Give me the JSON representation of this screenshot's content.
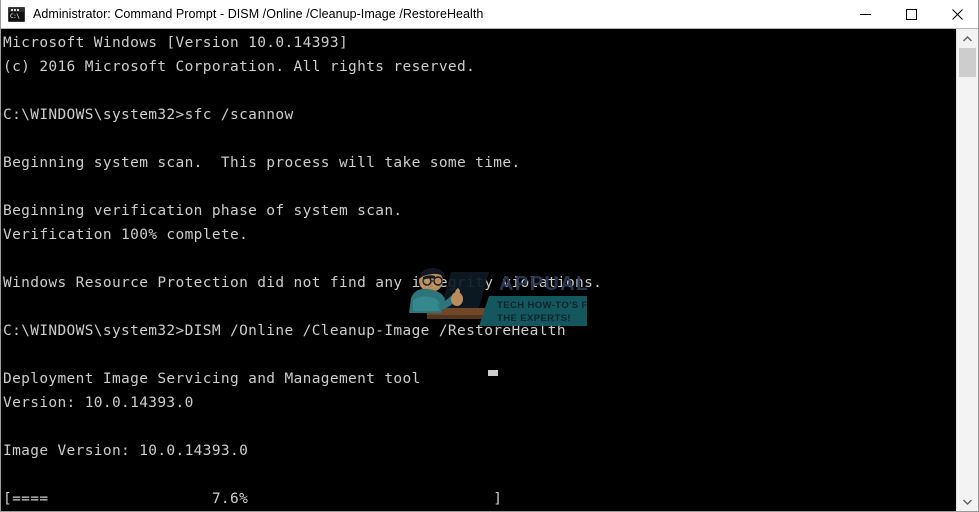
{
  "window": {
    "title": "Administrator: Command Prompt - DISM  /Online /Cleanup-Image /RestoreHealth",
    "icon_label": "C:\\",
    "icon_name": "command-prompt-icon",
    "background_color": "#000000",
    "titlebar_color": "#ffffff",
    "text_color": "#cccccc"
  },
  "controls": {
    "minimize_label": "Minimize",
    "maximize_label": "Maximize",
    "close_label": "Close"
  },
  "console": {
    "lines": [
      "Microsoft Windows [Version 10.0.14393]",
      "(c) 2016 Microsoft Corporation. All rights reserved.",
      "",
      "C:\\WINDOWS\\system32>sfc /scannow",
      "",
      "Beginning system scan.  This process will take some time.",
      "",
      "Beginning verification phase of system scan.",
      "Verification 100% complete.",
      "",
      "Windows Resource Protection did not find any integrity violations.",
      "",
      "C:\\WINDOWS\\system32>DISM /Online /Cleanup-Image /RestoreHealth",
      "",
      "Deployment Image Servicing and Management tool",
      "Version: 10.0.14393.0",
      "",
      "Image Version: 10.0.14393.0",
      "",
      "[====                  7.6%                           ]"
    ],
    "commands": [
      "sfc /scannow",
      "DISM /Online /Cleanup-Image /RestoreHealth"
    ],
    "prompt": "C:\\WINDOWS\\system32>",
    "progress_percent": "7.6%",
    "progress_bar_filled": "====",
    "windows_version": "10.0.14393",
    "dism_version": "10.0.14393.0",
    "image_version": "10.0.14393.0",
    "copyright": "(c) 2016 Microsoft Corporation. All rights reserved."
  },
  "watermark": {
    "brand": "APPUALS",
    "tagline_line1": "TECH HOW-TO'S FROM",
    "tagline_line2": "THE EXPERTS!",
    "brand_color": "#2b3a57",
    "tagline_color": "#1d6b75"
  },
  "scrollbar": {
    "up_arrow": "▲",
    "down_arrow": "▼"
  }
}
